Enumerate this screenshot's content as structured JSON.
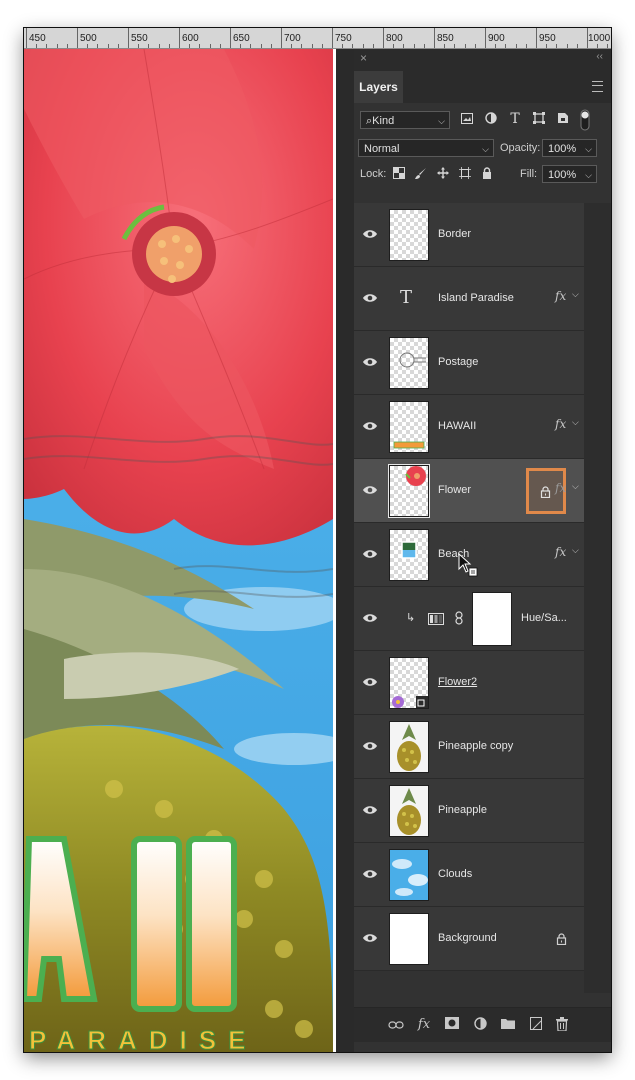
{
  "ruler": {
    "labels": [
      "450",
      "500",
      "550",
      "600",
      "650",
      "700",
      "750",
      "800",
      "850",
      "900",
      "950",
      "1000"
    ]
  },
  "canvas": {
    "artwork_text": "AII",
    "artwork_subtext": "PARADISE"
  },
  "panel": {
    "close_glyph": "×",
    "collapse_glyph": "‹‹",
    "tab_label": "Layers",
    "filter": {
      "label": "Kind",
      "search_glyph": "⌕"
    },
    "blend_mode": "Normal",
    "opacity_label": "Opacity:",
    "opacity_value": "100%",
    "lock_label": "Lock:",
    "fill_label": "Fill:",
    "fill_value": "100%",
    "fx_symbol": "fx",
    "type_symbol": "T"
  },
  "layers": [
    {
      "name": "Border",
      "fx": false,
      "locked": false,
      "selected": false,
      "thumb": "transparent"
    },
    {
      "name": "Island Paradise",
      "fx": true,
      "locked": false,
      "selected": false,
      "thumb": "type"
    },
    {
      "name": "Postage",
      "fx": false,
      "locked": false,
      "selected": false,
      "thumb": "stamp"
    },
    {
      "name": "HAWAII",
      "fx": true,
      "locked": false,
      "selected": false,
      "thumb": "hawaii-text"
    },
    {
      "name": "Flower",
      "fx": true,
      "locked": true,
      "selected": true,
      "thumb": "flower"
    },
    {
      "name": "Beach",
      "fx": true,
      "locked": false,
      "selected": false,
      "thumb": "beach"
    },
    {
      "name": "Hue/Sa...",
      "fx": false,
      "locked": false,
      "selected": false,
      "thumb": "adjustment"
    },
    {
      "name": "Flower2",
      "fx": false,
      "locked": false,
      "selected": false,
      "thumb": "flower2"
    },
    {
      "name": "Pineapple copy",
      "fx": false,
      "locked": false,
      "selected": false,
      "thumb": "pineapple"
    },
    {
      "name": "Pineapple",
      "fx": false,
      "locked": false,
      "selected": false,
      "thumb": "pineapple"
    },
    {
      "name": "Clouds",
      "fx": false,
      "locked": false,
      "selected": false,
      "thumb": "clouds"
    },
    {
      "name": "Background",
      "fx": false,
      "locked": true,
      "selected": false,
      "thumb": "white"
    }
  ],
  "footer": {
    "fx_label": "fx"
  },
  "colors": {
    "panel_bg": "#323232",
    "selected_row": "#505050",
    "highlight_box": "#e0894a",
    "flower_red": "#e8424f",
    "sky_blue": "#4aaee8",
    "hawaii_orange": "#f39a3a",
    "hawaii_stroke": "#4caf50"
  }
}
